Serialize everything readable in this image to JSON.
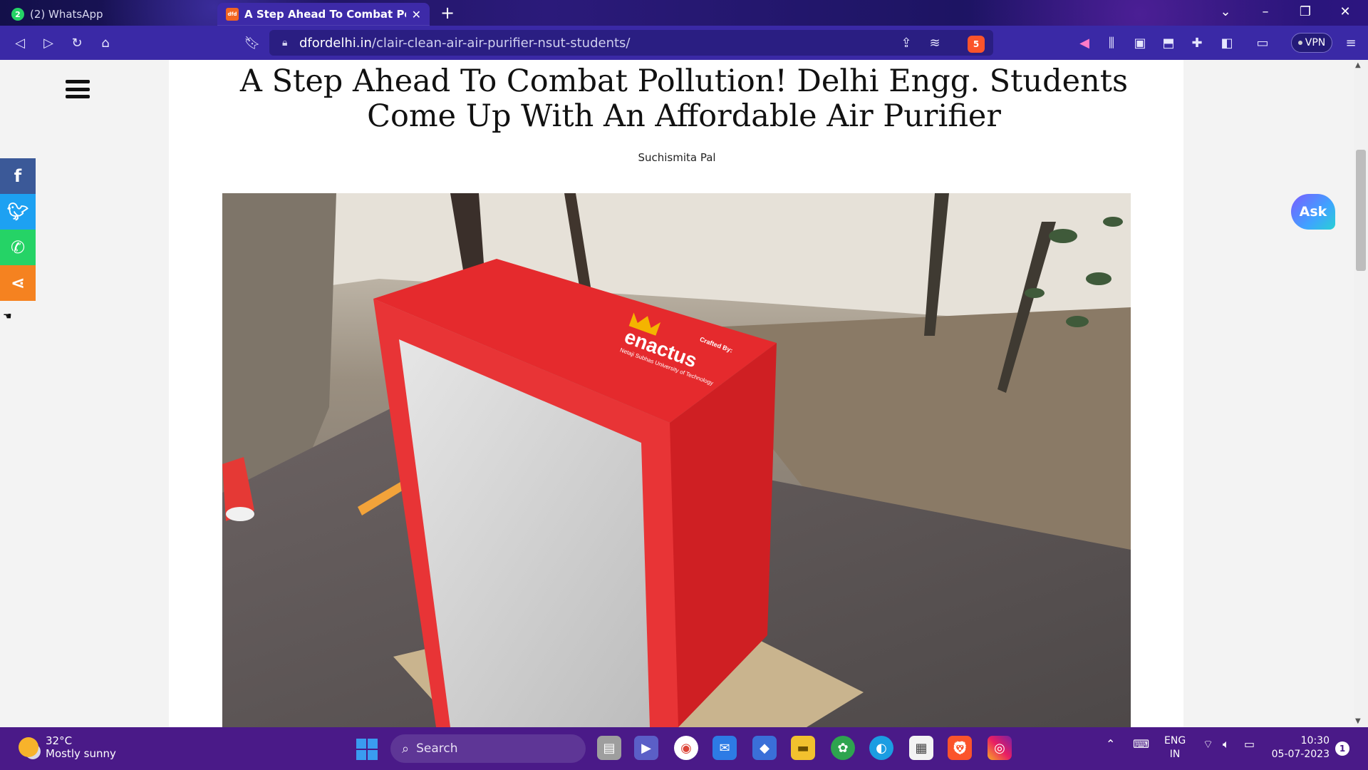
{
  "browser": {
    "tabs": [
      {
        "label": "(2) WhatsApp",
        "badge": "2"
      },
      {
        "label": "A Step Ahead To Combat Pollutio",
        "favicon": "dfd"
      }
    ],
    "url_domain": "dfordelhi.in",
    "url_path": "/clair-clean-air-air-purifier-nsut-students/",
    "brave_shield_count": "5",
    "vpn_label": "VPN"
  },
  "article": {
    "title": "A Step Ahead To Combat Pollution! Delhi Engg. Students Come Up With An Affordable Air Purifier",
    "author": "Suchismita Pal"
  },
  "hero_image": {
    "box_text_brand": "enactus",
    "box_text_crafted": "Crafted By:",
    "box_text_university": "Netaji Subhas University of Technology"
  },
  "widgets": {
    "ask_label": "Ask"
  },
  "taskbar": {
    "temperature": "32°C",
    "weather": "Mostly sunny",
    "search_label": "Search",
    "lang_line1": "ENG",
    "lang_line2": "IN",
    "time": "10:30",
    "date": "05-07-2023",
    "notification_count": "1"
  }
}
